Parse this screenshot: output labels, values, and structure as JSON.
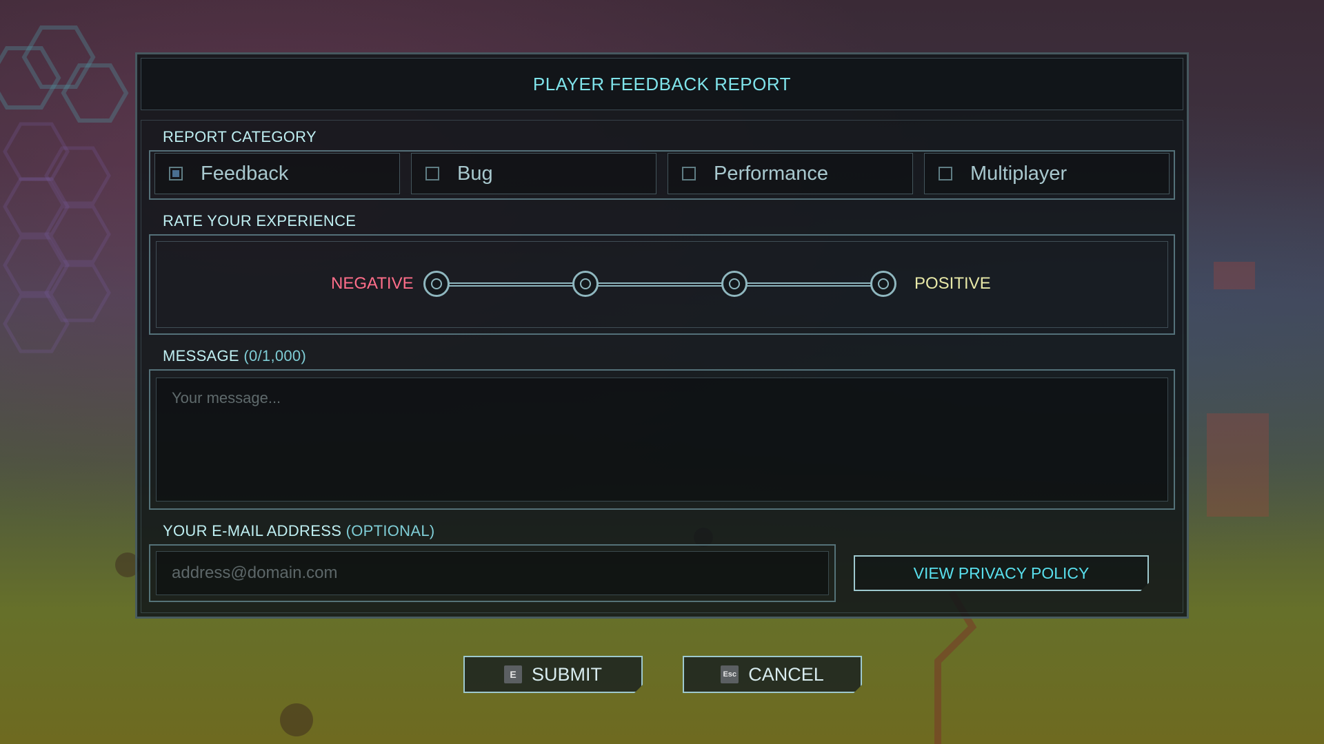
{
  "dialog": {
    "title": "PLAYER FEEDBACK REPORT"
  },
  "category": {
    "label": "REPORT CATEGORY",
    "options": [
      {
        "label": "Feedback",
        "checked": true
      },
      {
        "label": "Bug",
        "checked": false
      },
      {
        "label": "Performance",
        "checked": false
      },
      {
        "label": "Multiplayer",
        "checked": false
      }
    ]
  },
  "rating": {
    "label": "RATE YOUR EXPERIENCE",
    "negative_label": "NEGATIVE",
    "positive_label": "POSITIVE",
    "steps": 4
  },
  "message": {
    "label": "MESSAGE",
    "counter": "(0/1,000)",
    "placeholder": "Your message...",
    "value": ""
  },
  "email": {
    "label": "YOUR E-MAIL ADDRESS",
    "optional": "(OPTIONAL)",
    "placeholder": "address@domain.com",
    "value": ""
  },
  "privacy_button": "VIEW PRIVACY POLICY",
  "actions": {
    "submit": {
      "key": "E",
      "label": "SUBMIT"
    },
    "cancel": {
      "key": "Esc",
      "label": "CANCEL"
    }
  },
  "colors": {
    "accent": "#7fe3ea",
    "negative": "#ff6e8a",
    "positive": "#e8e9a8"
  }
}
